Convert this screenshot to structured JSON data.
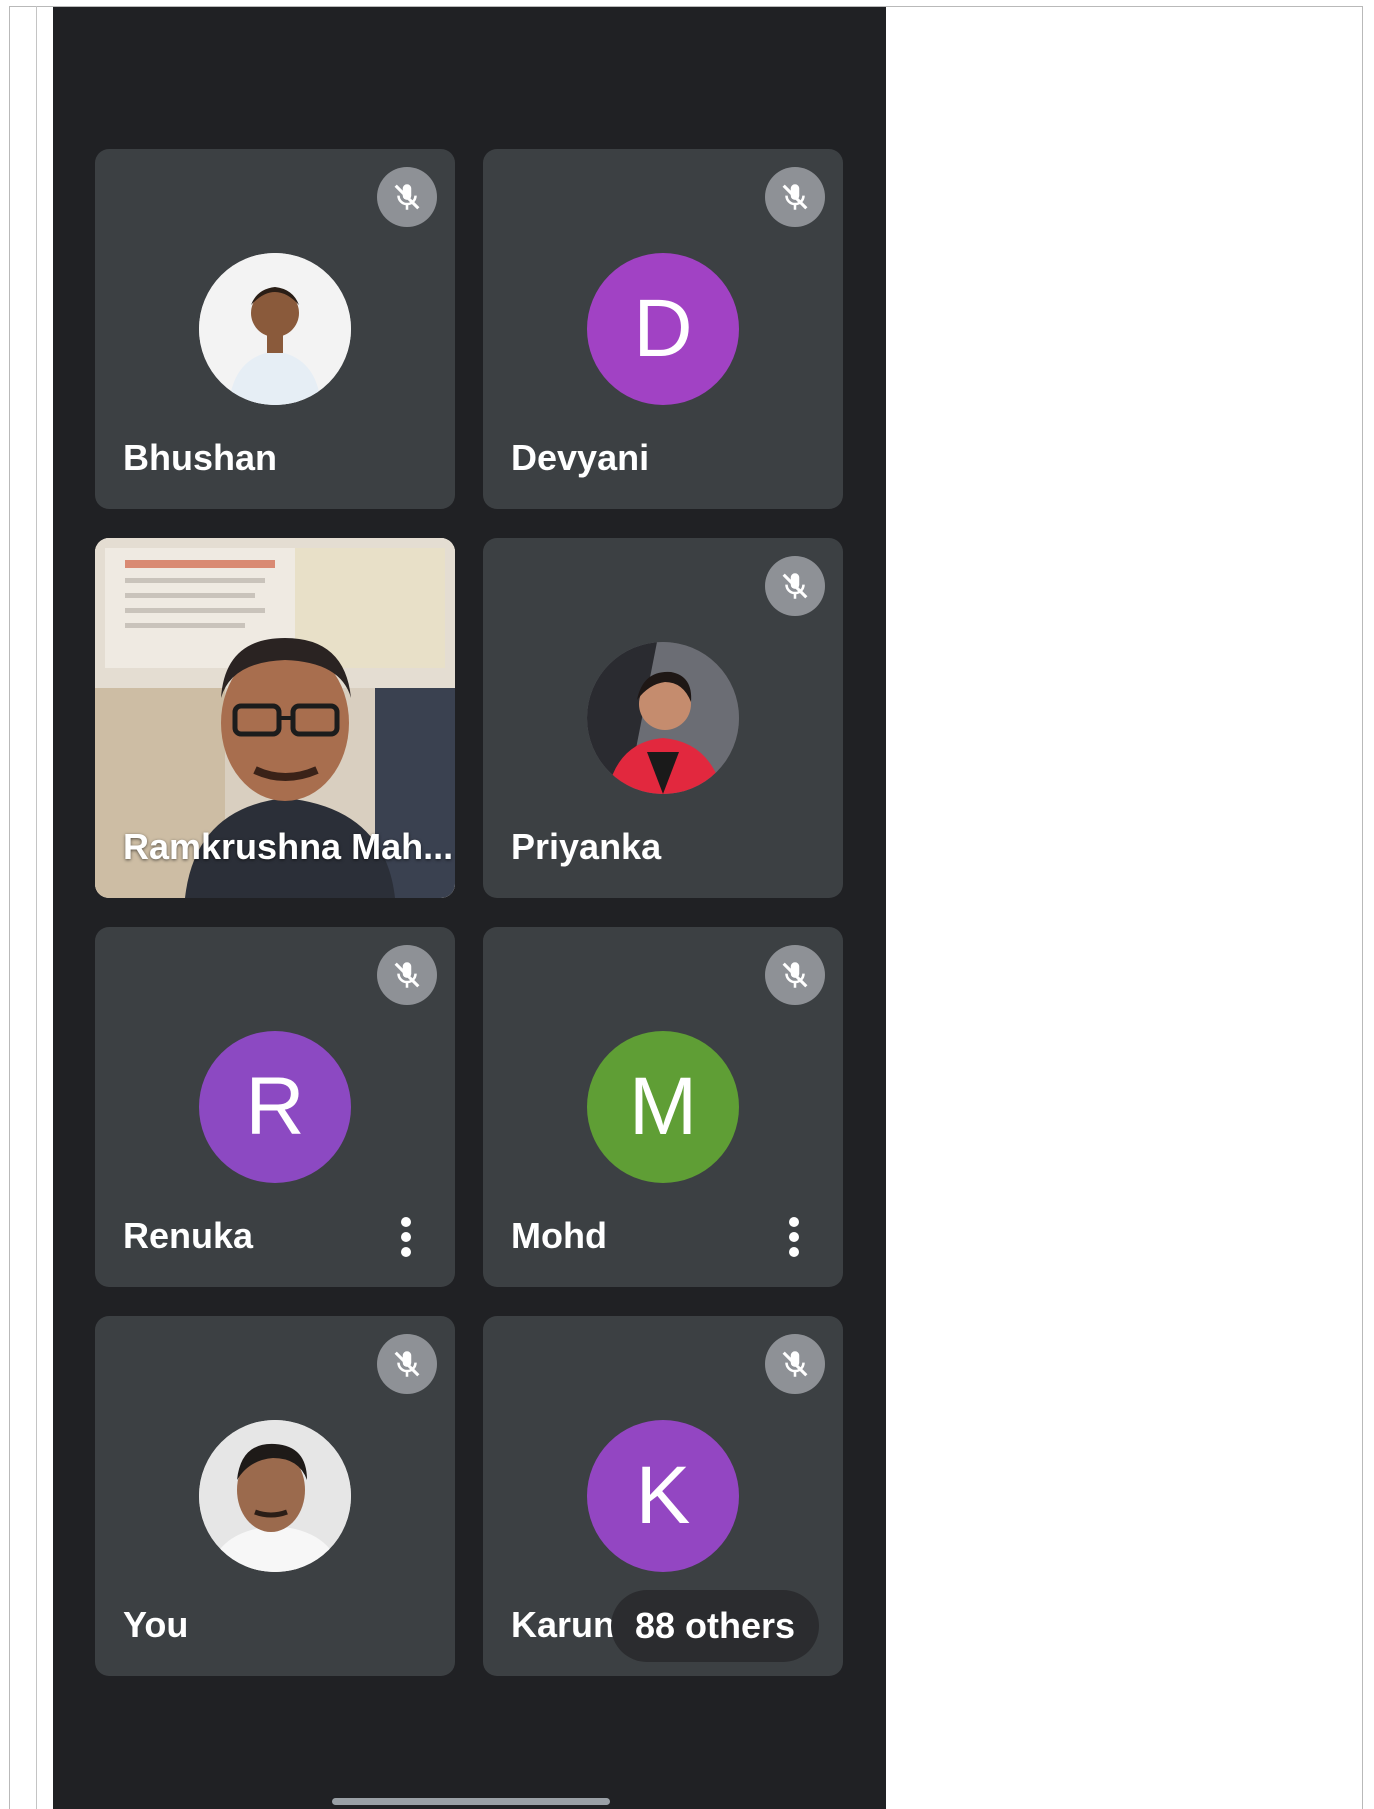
{
  "participants": [
    {
      "name": "Bhushan",
      "avatar_type": "photo",
      "muted": true
    },
    {
      "name": "Devyani",
      "avatar_type": "initial",
      "initial": "D",
      "avatar_color": "#a142c4",
      "muted": true
    },
    {
      "name": "Ramkrushna Mah...",
      "avatar_type": "video",
      "muted": false
    },
    {
      "name": "Priyanka",
      "avatar_type": "photo",
      "muted": true
    },
    {
      "name": "Renuka",
      "avatar_type": "initial",
      "initial": "R",
      "avatar_color": "#8c49c2",
      "muted": true,
      "has_menu": true
    },
    {
      "name": "Mohd",
      "avatar_type": "initial",
      "initial": "M",
      "avatar_color": "#5f9e35",
      "muted": true,
      "has_menu": true
    },
    {
      "name": "You",
      "avatar_type": "photo",
      "muted": true
    },
    {
      "name": "Karuna",
      "avatar_type": "initial",
      "initial": "K",
      "avatar_color": "#9346c2",
      "muted": true
    }
  ],
  "overflow": {
    "label": "88 others"
  },
  "icons": {
    "mute": "mic-off-icon",
    "menu": "more-vert-icon"
  },
  "colors": {
    "background": "#202124",
    "tile": "#3c4043",
    "mute_badge": "#8e9196"
  }
}
